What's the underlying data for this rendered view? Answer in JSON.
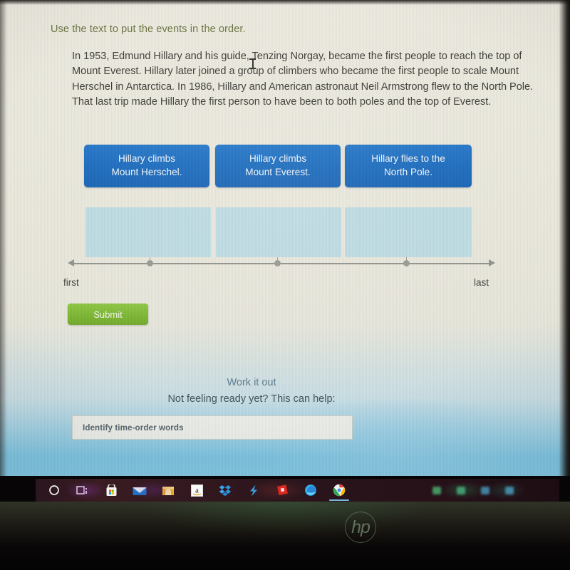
{
  "question": {
    "title": "Use the text to put the events in the order.",
    "passage": "In 1953, Edmund Hillary and his guide, Tenzing Norgay, became the first people to reach the top of Mount Everest. Hillary later joined a group of climbers who became the first people to scale Mount Herschel in Antarctica. In 1986, Hillary and American astronaut Neil Armstrong flew to the North Pole. That last trip made Hillary the first person to have been to both poles and the top of Everest."
  },
  "cards": [
    {
      "line1": "Hillary climbs",
      "line2": "Mount Herschel."
    },
    {
      "line1": "Hillary climbs",
      "line2": "Mount Everest."
    },
    {
      "line1": "Hillary flies to the",
      "line2": "North Pole."
    }
  ],
  "drop_zones": [
    {
      "value": ""
    },
    {
      "value": ""
    },
    {
      "value": ""
    }
  ],
  "timeline": {
    "first_label": "first",
    "last_label": "last",
    "marker_count": 3
  },
  "actions": {
    "submit_label": "Submit"
  },
  "work_it_out": {
    "title": "Work it out",
    "subtitle": "Not feeling ready yet? This can help:",
    "help_link": "Identify time-order words"
  },
  "taskbar": {
    "icons": [
      {
        "name": "cortana-icon",
        "glyph": "○"
      },
      {
        "name": "task-view-icon",
        "glyph": "⌸"
      },
      {
        "name": "microsoft-store-icon",
        "glyph": "⊞"
      },
      {
        "name": "mail-icon",
        "glyph": "✉"
      },
      {
        "name": "shopping-app-icon",
        "glyph": "ἾA"
      },
      {
        "name": "amazon-icon",
        "glyph": "a"
      },
      {
        "name": "dropbox-icon",
        "glyph": "❖"
      },
      {
        "name": "lightning-app-icon",
        "glyph": "⚡"
      },
      {
        "name": "roblox-icon",
        "glyph": "■"
      },
      {
        "name": "microsoft-edge-icon",
        "glyph": "e"
      },
      {
        "name": "google-chrome-icon",
        "glyph": "◉"
      }
    ]
  },
  "device": {
    "brand": "hp"
  },
  "colors": {
    "card_blue": "#1668bd",
    "drop_zone_blue": "#bcdbe2",
    "submit_green": "#7ab52f",
    "title_olive": "#6b7340",
    "work_it_out_slate": "#5a7a8c",
    "timeline_gray": "#8d9188"
  }
}
